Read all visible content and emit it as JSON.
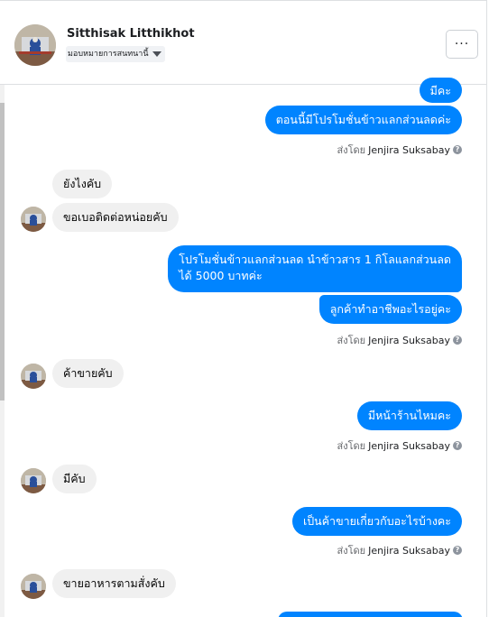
{
  "header": {
    "contact_name": "Sitthisak Litthikhot",
    "assign_label": "มอบหมายการสนทนานี้",
    "more_label": "···"
  },
  "sender_prefix": "ส่งโดย",
  "sender_name": "Jenjira Suksabay",
  "messages": [
    {
      "dir": "out",
      "text": "มีคะ"
    },
    {
      "dir": "out",
      "text": "ตอนนี้มีโปรโมชั่นข้าวแลกส่วนลดค่ะ"
    },
    {
      "dir": "in",
      "text": "ยังไงคับ"
    },
    {
      "dir": "in",
      "text": "ขอเบอติดต่อหน่อยคับ"
    },
    {
      "dir": "out",
      "lines": [
        "โปรโมชั่นข้าวแลกส่วนลด นำข้าวสาร 1 กิโลแลกส่วนลด",
        "ได้ 5000 บาทค่ะ"
      ]
    },
    {
      "dir": "out",
      "text": "ลูกค้าทำอาชีพอะไรอยู่คะ"
    },
    {
      "dir": "in",
      "text": "ค้าขายคับ"
    },
    {
      "dir": "out",
      "text": "มีหน้าร้านไหมคะ"
    },
    {
      "dir": "in",
      "text": "มีคับ"
    },
    {
      "dir": "out",
      "text": "เป็นค้าขายเกี่ยวกับอะไรบ้างคะ"
    },
    {
      "dir": "in",
      "text": "ขายอาหารตามสั่งคับ"
    }
  ],
  "colors": {
    "outgoing": "#0084ff",
    "incoming": "#f0f0f0"
  }
}
